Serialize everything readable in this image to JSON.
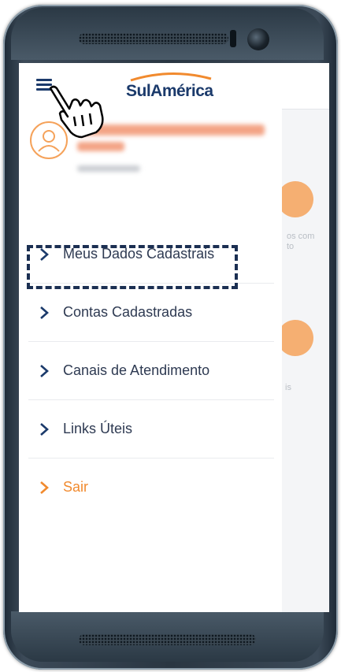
{
  "app": {
    "brand": "SulAmérica",
    "brand_color": "#1b3a6b",
    "accent_color": "#f18a2e"
  },
  "header": {
    "menu_icon": "hamburger-menu-icon",
    "pointer_icon": "hand-pointer-icon"
  },
  "drawer": {
    "user_avatar_icon": "user-avatar-icon",
    "menu_items": [
      {
        "label": "Meus Dados Cadastrais",
        "icon": "chevron-right-icon"
      },
      {
        "label": "Contas Cadastradas",
        "icon": "chevron-right-icon",
        "highlighted": true
      },
      {
        "label": "Canais de Atendimento",
        "icon": "chevron-right-icon"
      },
      {
        "label": "Links Úteis",
        "icon": "chevron-right-icon"
      },
      {
        "label": "Sair",
        "icon": "chevron-right-icon"
      }
    ]
  },
  "background": {
    "snippet_1": "os com",
    "snippet_2": "to",
    "snippet_3": "is"
  }
}
